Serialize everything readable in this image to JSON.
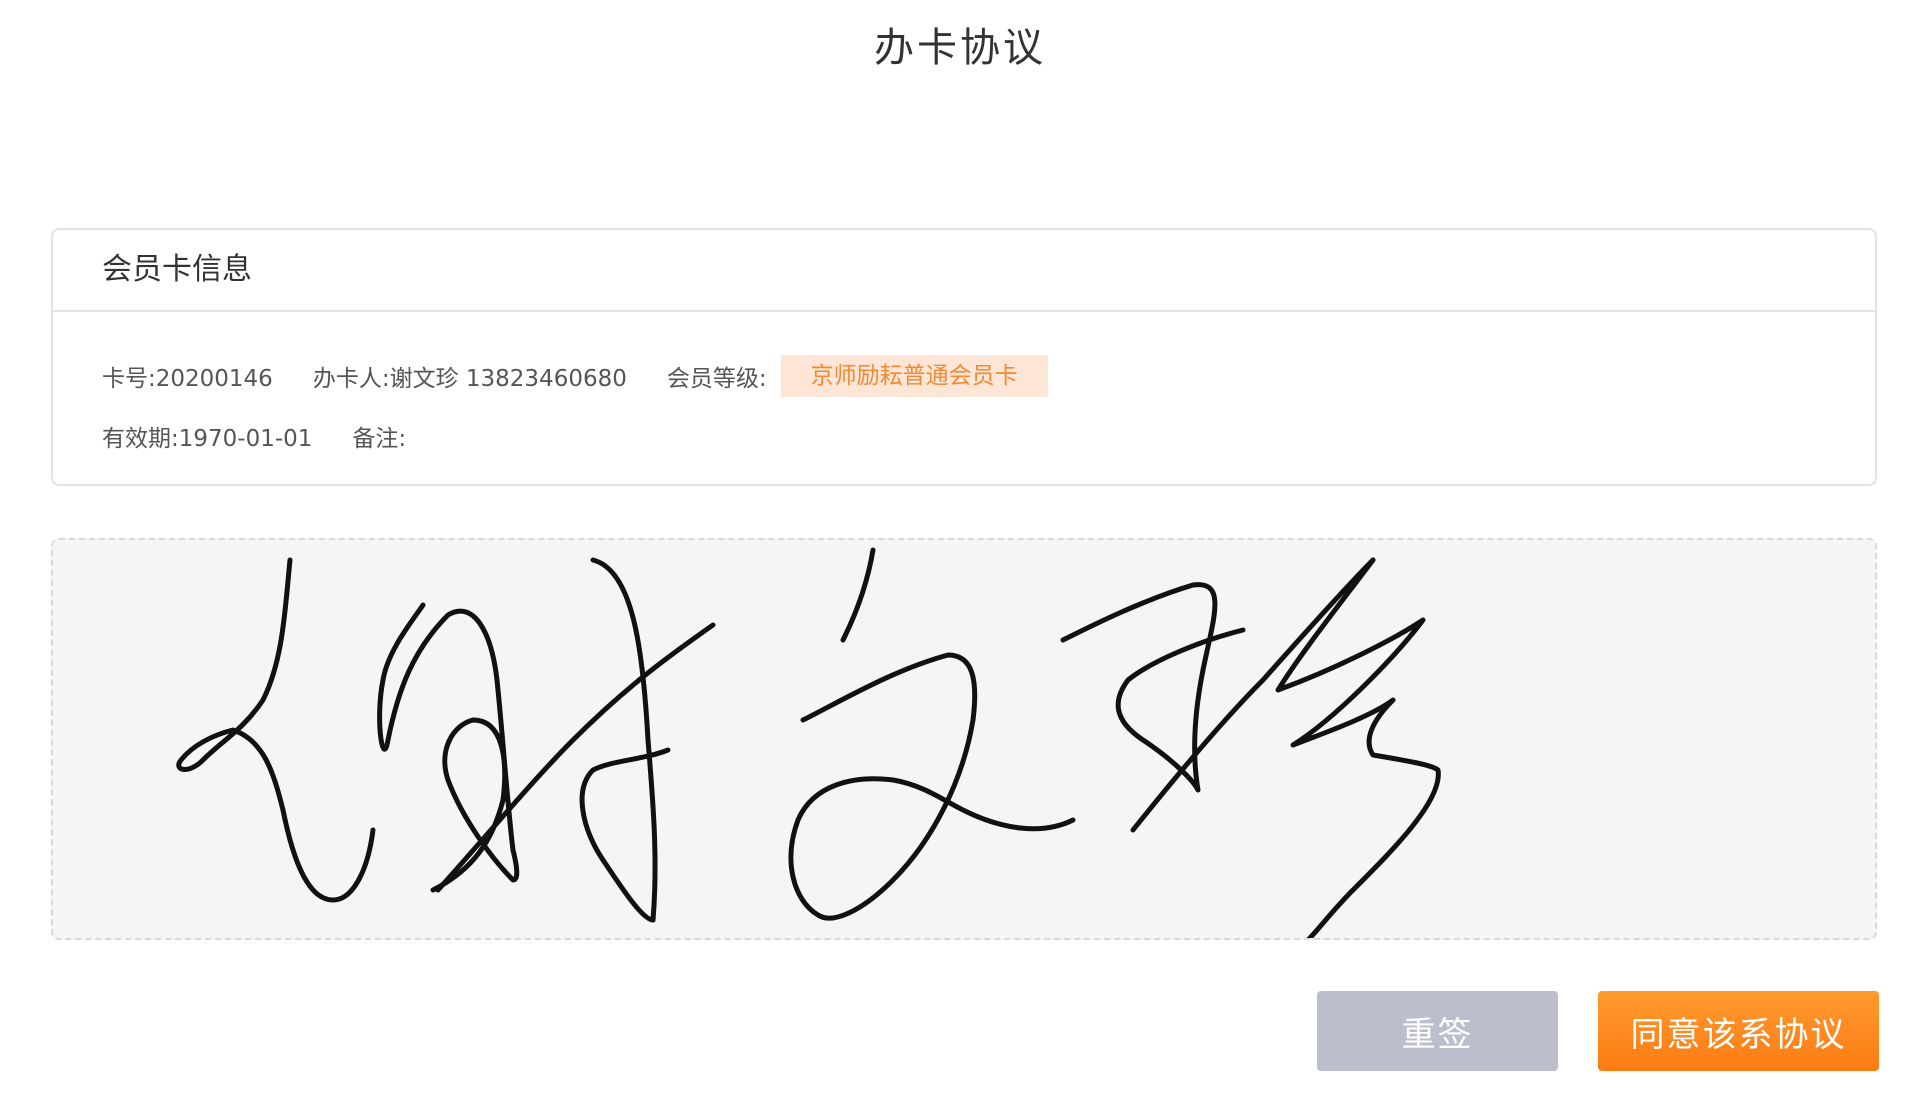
{
  "page": {
    "title": "办卡协议"
  },
  "card_info": {
    "header": "会员卡信息",
    "card_no": "卡号:20200146",
    "handler": "办卡人:谢文珍 13823460680",
    "level_label": "会员等级:",
    "level_value": "京师励耘普通会员卡",
    "valid_until": "有效期:1970-01-01",
    "remark": "备注:"
  },
  "signature": {
    "stroke_color": "#111111",
    "background_color": "#f7f4f6"
  },
  "actions": {
    "resign_label": "重签",
    "agree_label": "同意该系协议"
  },
  "colors": {
    "accent_orange": "#fb7b14",
    "badge_bg": "#fde6d5",
    "badge_text": "#f08a35",
    "button_gray": "#bbbfcb"
  }
}
